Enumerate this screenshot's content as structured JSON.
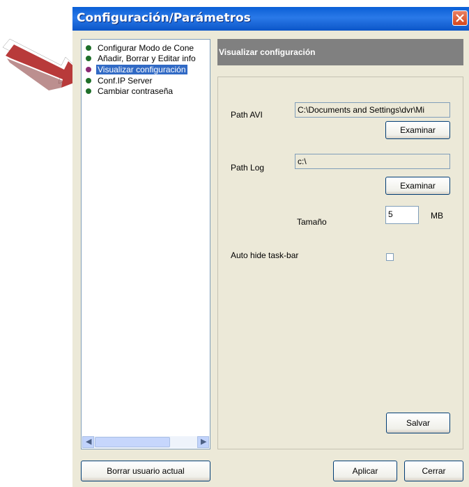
{
  "window": {
    "title": "Configuración/Parámetros"
  },
  "tree": {
    "items": [
      {
        "label": "Configurar Modo de Cone",
        "selected": false
      },
      {
        "label": "Añadir, Borrar y Editar info",
        "selected": false
      },
      {
        "label": "Visualizar configuración",
        "selected": true
      },
      {
        "label": "Conf.IP Server",
        "selected": false
      },
      {
        "label": "Cambiar contraseña",
        "selected": false
      }
    ]
  },
  "panel": {
    "header": "Visualizar configuración",
    "path_avi": {
      "label": "Path AVI",
      "value": "C:\\Documents and Settings\\dvr\\Mi",
      "browse": "Examinar"
    },
    "path_log": {
      "label": "Path Log",
      "value": "c:\\",
      "browse": "Examinar"
    },
    "size": {
      "label": "Tamaño",
      "value": "5",
      "unit": "MB"
    },
    "autohide": {
      "label": "Auto hide task-bar",
      "checked": false
    },
    "save": "Salvar"
  },
  "footer": {
    "delete_user": "Borrar usuario actual",
    "apply": "Aplicar",
    "close": "Cerrar"
  },
  "colors": {
    "titlebar": "#0a5fd6",
    "selection": "#316ac5",
    "arrow": "#b83a3a"
  }
}
